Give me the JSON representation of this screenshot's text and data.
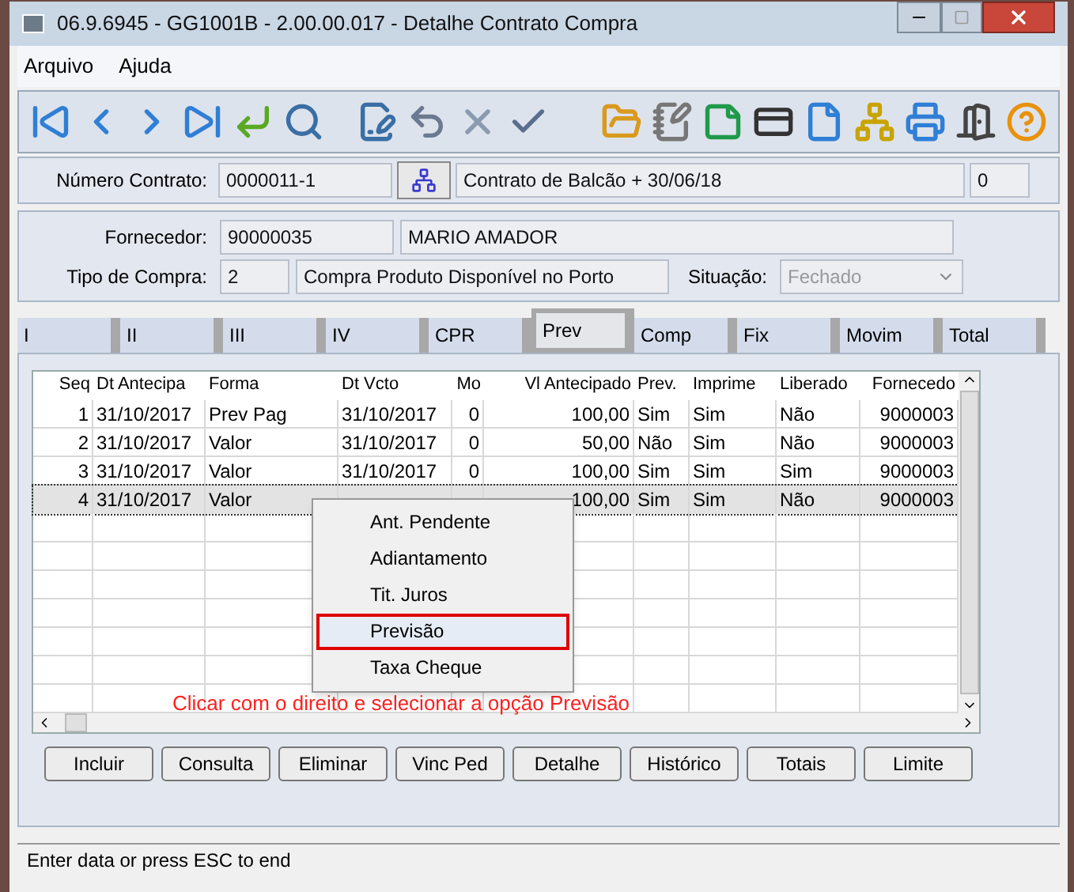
{
  "window": {
    "title": "06.9.6945 - GG1001B - 2.00.00.017 - Detalhe Contrato Compra"
  },
  "menu": [
    "Arquivo",
    "Ajuda"
  ],
  "contract": {
    "label": "Número Contrato:",
    "number": "0000011-1",
    "description": "Contrato de Balcão + 30/06/18",
    "count": "0"
  },
  "supplier": {
    "label": "Fornecedor:",
    "code": "90000035",
    "name": "MARIO AMADOR"
  },
  "purchase_type": {
    "label": "Tipo de Compra:",
    "code": "2",
    "description": "Compra Produto Disponível no Porto"
  },
  "status": {
    "label": "Situação:",
    "value": "Fechado",
    "disabled": true
  },
  "tabs": [
    {
      "label": "I",
      "selected": false
    },
    {
      "label": "II",
      "selected": false
    },
    {
      "label": "III",
      "selected": false
    },
    {
      "label": "IV",
      "selected": false
    },
    {
      "label": "CPR",
      "selected": false
    },
    {
      "label": "Prev",
      "selected": true
    },
    {
      "label": "Comp",
      "selected": false
    },
    {
      "label": "Fix",
      "selected": false
    },
    {
      "label": "Movim",
      "selected": false
    },
    {
      "label": "Total",
      "selected": false
    }
  ],
  "table": {
    "columns": [
      "Seq",
      "Dt Antecipa",
      "Forma",
      "Dt Vcto",
      "Mo",
      "Vl Antecipado",
      "Prev.",
      "Imprime",
      "Liberado",
      "Fornecedo"
    ],
    "rows": [
      {
        "selected": false,
        "cells": [
          "1",
          "31/10/2017",
          "Prev Pag",
          "31/10/2017",
          "0",
          "100,00",
          "Sim",
          "Sim",
          "Não",
          "9000003"
        ]
      },
      {
        "selected": false,
        "cells": [
          "2",
          "31/10/2017",
          "Valor",
          "31/10/2017",
          "0",
          "50,00",
          "Não",
          "Sim",
          "Não",
          "9000003"
        ]
      },
      {
        "selected": false,
        "cells": [
          "3",
          "31/10/2017",
          "Valor",
          "31/10/2017",
          "0",
          "100,00",
          "Sim",
          "Sim",
          "Sim",
          "9000003"
        ]
      },
      {
        "selected": true,
        "cells": [
          "4",
          "31/10/2017",
          "Valor",
          null,
          null,
          "100,00",
          "Sim",
          "Sim",
          "Não",
          "9000003"
        ]
      }
    ]
  },
  "context_menu": [
    {
      "label": "Ant. Pendente",
      "highlighted": false
    },
    {
      "label": "Adiantamento",
      "highlighted": false
    },
    {
      "label": "Tit. Juros",
      "highlighted": false
    },
    {
      "label": "Previsão",
      "highlighted": true
    },
    {
      "label": "Taxa Cheque",
      "highlighted": false
    }
  ],
  "annotation": "Clicar com o direito e selecionar a opção Previsão",
  "buttons": [
    "Incluir",
    "Consulta",
    "Eliminar",
    "Vinc Ped",
    "Detalhe",
    "Histórico",
    "Totais",
    "Limite"
  ],
  "status_bar": "Enter data or press ESC to end"
}
